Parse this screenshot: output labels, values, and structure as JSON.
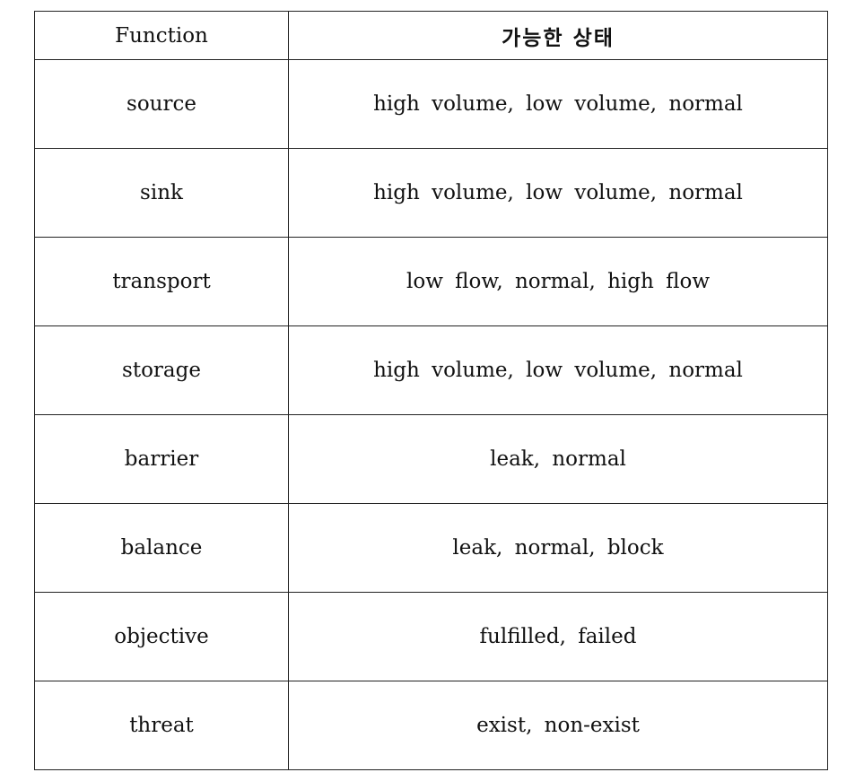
{
  "table": {
    "headers": [
      "Function",
      "가능한 상태"
    ],
    "rows": [
      {
        "function": "source",
        "states": "high volume, low volume, normal"
      },
      {
        "function": "sink",
        "states": "high volume, low volume, normal"
      },
      {
        "function": "transport",
        "states": "low flow, normal, high flow"
      },
      {
        "function": "storage",
        "states": "high volume, low volume, normal"
      },
      {
        "function": "barrier",
        "states": "leak, normal"
      },
      {
        "function": "balance",
        "states": "leak, normal, block"
      },
      {
        "function": "objective",
        "states": "fulfilled, failed"
      },
      {
        "function": "threat",
        "states": "exist, non-exist"
      }
    ]
  }
}
